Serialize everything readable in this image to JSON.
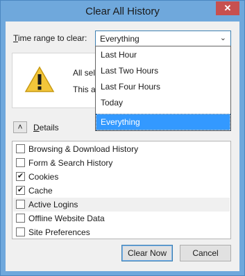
{
  "window": {
    "title": "Clear All History",
    "close_glyph": "✕"
  },
  "time_range": {
    "label_prefix": "T",
    "label_rest": "ime range to clear:",
    "selected": "Everything",
    "arrow_glyph": "⌄",
    "options": [
      "Last Hour",
      "Last Two Hours",
      "Last Four Hours",
      "Today",
      "Everything"
    ]
  },
  "warning": {
    "icon": "warning-triangle-icon",
    "line1": "All sele",
    "line2": "This ac"
  },
  "details": {
    "toggle_glyph": "˄",
    "label_prefix": "D",
    "label_rest": "etails"
  },
  "items": [
    {
      "label": "Browsing & Download History",
      "checked": false
    },
    {
      "label": "Form & Search History",
      "checked": false
    },
    {
      "label": "Cookies",
      "checked": true
    },
    {
      "label": "Cache",
      "checked": true
    },
    {
      "label": "Active Logins",
      "checked": false
    },
    {
      "label": "Offline Website Data",
      "checked": false
    },
    {
      "label": "Site Preferences",
      "checked": false
    }
  ],
  "buttons": {
    "clear_now": "Clear Now",
    "cancel": "Cancel"
  },
  "colors": {
    "titlebar": "#6fa8dc",
    "close_button": "#c7504f",
    "selection": "#3399ff"
  }
}
